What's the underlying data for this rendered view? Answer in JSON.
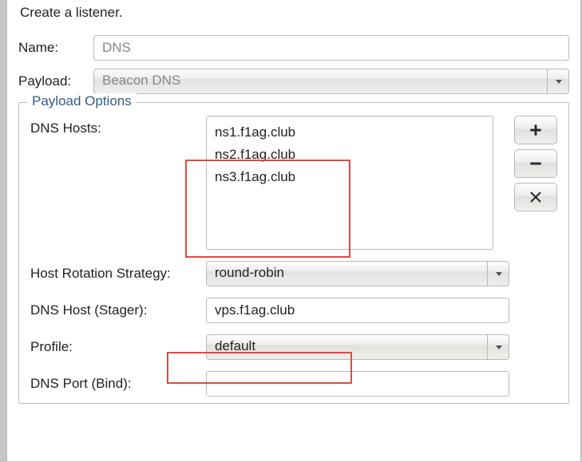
{
  "heading": "Create a listener.",
  "labels": {
    "name": "Name:",
    "payload": "Payload:",
    "payload_options": "Payload Options",
    "dns_hosts": "DNS Hosts:",
    "host_rotation": "Host Rotation Strategy:",
    "dns_host_stager": "DNS Host (Stager):",
    "profile": "Profile:",
    "dns_port_bind": "DNS Port (Bind):"
  },
  "values": {
    "name": "DNS",
    "payload": "Beacon DNS",
    "dns_hosts": [
      "ns1.f1ag.club",
      "ns2.f1ag.club",
      "ns3.f1ag.club"
    ],
    "host_rotation": "round-robin",
    "dns_host_stager": "vps.f1ag.club",
    "profile": "default",
    "dns_port_bind": ""
  },
  "icons": {
    "add": "plus-icon",
    "remove": "minus-icon",
    "clear": "close-icon",
    "dropdown": "chevron-down-icon"
  }
}
